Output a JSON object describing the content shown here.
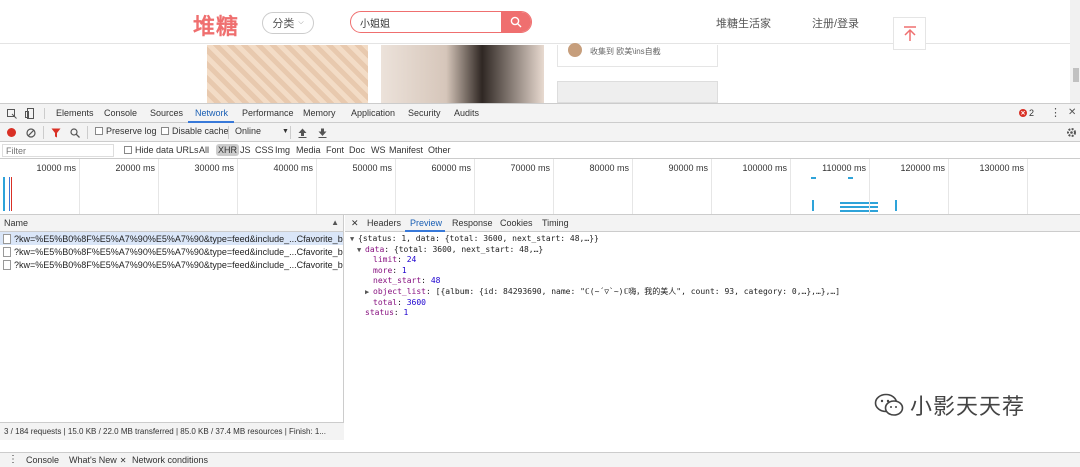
{
  "site": {
    "logo": "堆糖",
    "category_label": "分类",
    "search_value": "小姐姐",
    "nav_life": "堆糖生活家",
    "nav_login": "注册/登录",
    "card_text": "收集到  欧美\\ins自截"
  },
  "devtools": {
    "tabs": [
      "Elements",
      "Console",
      "Sources",
      "Network",
      "Performance",
      "Memory",
      "Application",
      "Security",
      "Audits"
    ],
    "active_tab": "Network",
    "error_count": "2",
    "toolbar": {
      "preserve_log": "Preserve log",
      "disable_cache": "Disable cache",
      "throttle": "Online"
    },
    "filter": {
      "placeholder": "Filter",
      "hide_data_urls": "Hide data URLs",
      "types": [
        "All",
        "XHR",
        "JS",
        "CSS",
        "Img",
        "Media",
        "Font",
        "Doc",
        "WS",
        "Manifest",
        "Other"
      ],
      "selected_type": "XHR"
    },
    "timeline_ticks": [
      "10000 ms",
      "20000 ms",
      "30000 ms",
      "40000 ms",
      "50000 ms",
      "60000 ms",
      "70000 ms",
      "80000 ms",
      "90000 ms",
      "100000 ms",
      "110000 ms",
      "120000 ms",
      "130000 ms",
      "140"
    ],
    "request_list": {
      "header": "Name",
      "rows": [
        "?kw=%E5%B0%8F%E5%A7%90%E5%A7%90&type=feed&include_...Cfavorite_blog_id&...",
        "?kw=%E5%B0%8F%E5%A7%90%E5%A7%90&type=feed&include_...Cfavorite_blog_id&...",
        "?kw=%E5%B0%8F%E5%A7%90%E5%A7%90&type=feed&include_...Cfavorite_blog_id&..."
      ],
      "status": "3 / 184 requests  |  15.0 KB / 22.0 MB transferred  |  85.0 KB / 37.4 MB resources  |  Finish: 1..."
    },
    "detail_tabs": [
      "Headers",
      "Preview",
      "Response",
      "Cookies",
      "Timing"
    ],
    "active_detail_tab": "Preview",
    "preview": {
      "root": "{status: 1, data: {total: 3600, next_start: 48,…}}",
      "data_summary": "{total: 3600, next_start: 48,…}",
      "limit": "24",
      "more": "1",
      "next_start": "48",
      "object_list": "[{album: {id: 84293690, name: \"ℂ(~´▽`~)ℂ嗨，我的美人\", count: 93, category: 0,…},…},…]",
      "total": "3600",
      "status": "1"
    },
    "drawer_tabs": [
      "Console",
      "What's New",
      "Network conditions"
    ]
  },
  "watermark": "小影天天荐"
}
